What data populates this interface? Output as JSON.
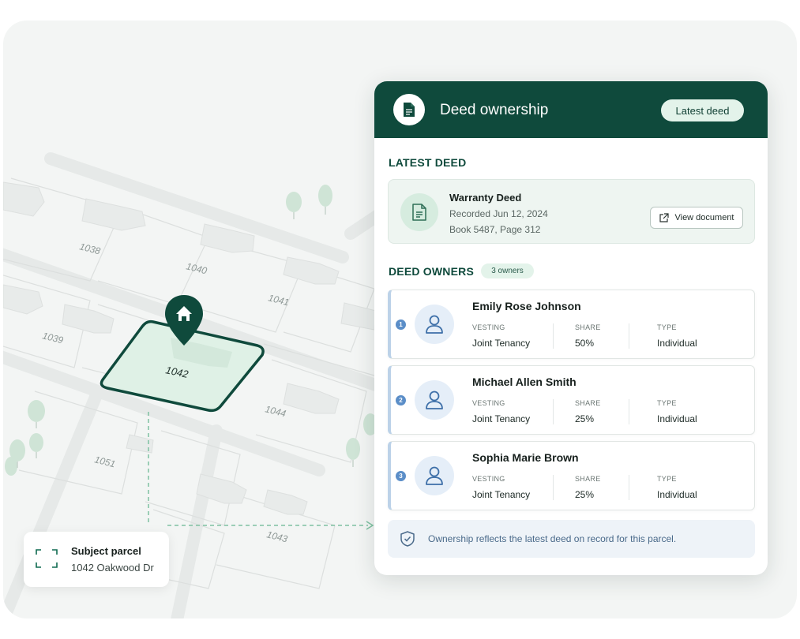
{
  "map": {
    "lot_labels": [
      "1038",
      "1040",
      "1041",
      "1039",
      "1042",
      "1044",
      "1051",
      "1043"
    ],
    "marker_icon": "home-icon"
  },
  "subject_parcel": {
    "title": "Subject parcel",
    "address": "1042 Oakwood Dr",
    "icon": "frame-corners-icon"
  },
  "card": {
    "title": "Deed ownership",
    "badge": "Latest deed",
    "header_icon": "document-icon",
    "latest_deed": {
      "section_label": "LATEST DEED",
      "name": "Warranty Deed",
      "recorded": "Recorded Jun 12, 2024",
      "book": "Book 5487, Page 312",
      "view_button": "View document"
    },
    "owners": {
      "section_label": "DEED OWNERS",
      "count_badge": "3 owners",
      "columns": {
        "vesting": "VESTING",
        "share": "SHARE",
        "type": "TYPE"
      },
      "list": [
        {
          "index": "1",
          "name": "Emily Rose Johnson",
          "vesting": "Joint Tenancy",
          "share": "50%",
          "type": "Individual"
        },
        {
          "index": "2",
          "name": "Michael Allen Smith",
          "vesting": "Joint Tenancy",
          "share": "25%",
          "type": "Individual"
        },
        {
          "index": "3",
          "name": "Sophia Marie Brown",
          "vesting": "Joint Tenancy",
          "share": "25%",
          "type": "Individual"
        }
      ]
    },
    "note": "Ownership reflects the latest deed on record for this parcel."
  },
  "colors": {
    "brand_dark_green": "#0f4a3c",
    "mint": "#e3f3ea",
    "parcel_fill": "#dff1e6",
    "owner_accent": "#5b8ec8",
    "background": "#f3f5f4"
  }
}
